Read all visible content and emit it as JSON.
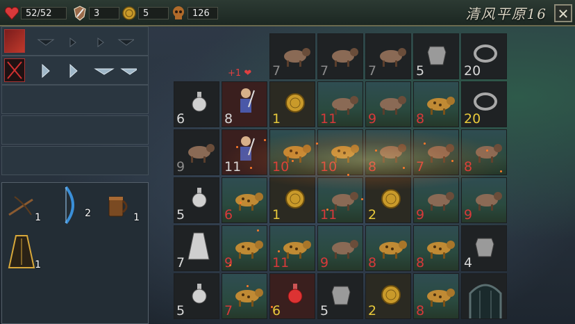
{
  "topbar": {
    "hp": "52/52",
    "attack": "3",
    "gold": "5",
    "kills": "126",
    "title": "清风平原16",
    "close_label": "✕"
  },
  "popup": {
    "text": "+1"
  },
  "colors": {
    "hp_red": "#d8393a",
    "gold": "#e8c93b",
    "frame": "#4a5560"
  },
  "skills": [
    {
      "icon": "axe-skill-icon"
    },
    {
      "icon": "crossed-swords-skill-icon"
    }
  ],
  "inventory": [
    {
      "icon": "crossbow-icon",
      "count": "1"
    },
    {
      "icon": "blue-bow-icon",
      "count": "2"
    },
    {
      "icon": "wooden-mug-icon",
      "count": "1"
    },
    {
      "icon": "golden-cloak-icon",
      "count": "1"
    }
  ],
  "grid": [
    {
      "r": 0,
      "c": 2,
      "kind": "hyena",
      "num": "7",
      "color": "g"
    },
    {
      "r": 0,
      "c": 3,
      "kind": "hyena",
      "num": "7",
      "color": "g"
    },
    {
      "r": 0,
      "c": 4,
      "kind": "hyena",
      "num": "7",
      "color": "g"
    },
    {
      "r": 0,
      "c": 5,
      "kind": "armor",
      "num": "5",
      "color": "w"
    },
    {
      "r": 0,
      "c": 6,
      "kind": "pot",
      "num": "20",
      "color": "w"
    },
    {
      "r": 1,
      "c": 0,
      "kind": "potion",
      "num": "6",
      "color": "w"
    },
    {
      "r": 1,
      "c": 1,
      "kind": "hero",
      "num": "8",
      "color": "w"
    },
    {
      "r": 1,
      "c": 2,
      "kind": "coin",
      "num": "1",
      "color": "y"
    },
    {
      "r": 1,
      "c": 3,
      "kind": "hyena",
      "num": "11",
      "color": "r"
    },
    {
      "r": 1,
      "c": 4,
      "kind": "hyena",
      "num": "9",
      "color": "r"
    },
    {
      "r": 1,
      "c": 5,
      "kind": "leopard",
      "num": "8",
      "color": "r"
    },
    {
      "r": 1,
      "c": 6,
      "kind": "pot",
      "num": "20",
      "color": "y"
    },
    {
      "r": 2,
      "c": 0,
      "kind": "hyena",
      "num": "9",
      "color": "g"
    },
    {
      "r": 2,
      "c": 1,
      "kind": "hero",
      "num": "11",
      "color": "w"
    },
    {
      "r": 2,
      "c": 2,
      "kind": "leopard",
      "num": "10",
      "color": "r"
    },
    {
      "r": 2,
      "c": 3,
      "kind": "leopard",
      "num": "10",
      "color": "r"
    },
    {
      "r": 2,
      "c": 4,
      "kind": "hyena",
      "num": "8",
      "color": "r"
    },
    {
      "r": 2,
      "c": 5,
      "kind": "hyena",
      "num": "7",
      "color": "r"
    },
    {
      "r": 2,
      "c": 6,
      "kind": "hyena",
      "num": "8",
      "color": "r"
    },
    {
      "r": 3,
      "c": 0,
      "kind": "potion",
      "num": "5",
      "color": "w"
    },
    {
      "r": 3,
      "c": 1,
      "kind": "leopard",
      "num": "6",
      "color": "r"
    },
    {
      "r": 3,
      "c": 2,
      "kind": "coin",
      "num": "1",
      "color": "y"
    },
    {
      "r": 3,
      "c": 3,
      "kind": "hyena",
      "num": "11",
      "color": "r"
    },
    {
      "r": 3,
      "c": 4,
      "kind": "coin",
      "num": "2",
      "color": "y"
    },
    {
      "r": 3,
      "c": 5,
      "kind": "hyena",
      "num": "9",
      "color": "r"
    },
    {
      "r": 3,
      "c": 6,
      "kind": "hyena",
      "num": "9",
      "color": "r"
    },
    {
      "r": 4,
      "c": 0,
      "kind": "cloak",
      "num": "7",
      "color": "w"
    },
    {
      "r": 4,
      "c": 1,
      "kind": "leopard",
      "num": "9",
      "color": "r"
    },
    {
      "r": 4,
      "c": 2,
      "kind": "leopard",
      "num": "11",
      "color": "r"
    },
    {
      "r": 4,
      "c": 3,
      "kind": "hyena",
      "num": "9",
      "color": "r"
    },
    {
      "r": 4,
      "c": 4,
      "kind": "leopard",
      "num": "8",
      "color": "r"
    },
    {
      "r": 4,
      "c": 5,
      "kind": "leopard",
      "num": "8",
      "color": "r"
    },
    {
      "r": 4,
      "c": 6,
      "kind": "armor",
      "num": "4",
      "color": "w"
    },
    {
      "r": 5,
      "c": 0,
      "kind": "potion",
      "num": "5",
      "color": "w"
    },
    {
      "r": 5,
      "c": 1,
      "kind": "leopard",
      "num": "7",
      "color": "r"
    },
    {
      "r": 5,
      "c": 2,
      "kind": "redpotion",
      "num": "6",
      "color": "y"
    },
    {
      "r": 5,
      "c": 3,
      "kind": "armor",
      "num": "5",
      "color": "w"
    },
    {
      "r": 5,
      "c": 4,
      "kind": "coin",
      "num": "2",
      "color": "y"
    },
    {
      "r": 5,
      "c": 5,
      "kind": "leopard",
      "num": "8",
      "color": "r"
    },
    {
      "r": 5,
      "c": 6,
      "kind": "gate",
      "num": "",
      "color": "w"
    }
  ]
}
